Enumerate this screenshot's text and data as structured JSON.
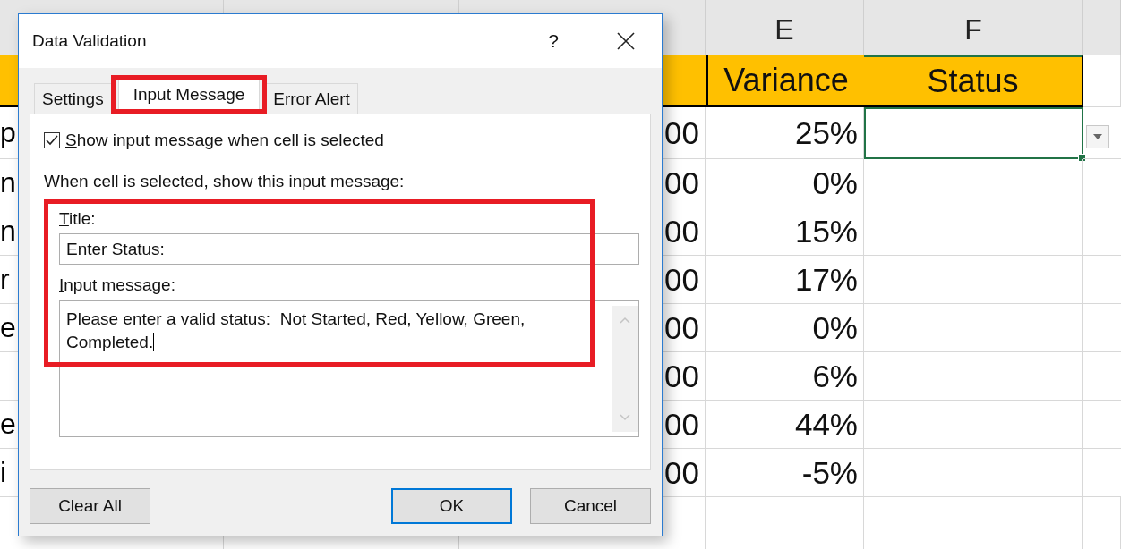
{
  "sheet": {
    "column_letters": [
      "E",
      "F"
    ],
    "header_row": [
      "Variance",
      "Status"
    ],
    "rows": [
      {
        "column_a": "p",
        "column_d": "00",
        "variance": "25%",
        "selected": true
      },
      {
        "column_a": "n",
        "column_d": "00",
        "variance": "0%",
        "selected": false
      },
      {
        "column_a": "n",
        "column_d": "00",
        "variance": "15%",
        "selected": false
      },
      {
        "column_a": "r",
        "column_d": "00",
        "variance": "17%",
        "selected": false
      },
      {
        "column_a": "e",
        "column_d": "00",
        "variance": "0%",
        "selected": false
      },
      {
        "column_d": "00",
        "variance": "6%",
        "selected": false
      },
      {
        "column_a": "e",
        "column_d": "00",
        "variance": "44%",
        "selected": false
      },
      {
        "column_a": "i",
        "column_d": "00",
        "variance": "-5%",
        "selected": false
      }
    ]
  },
  "dialog": {
    "title": "Data Validation",
    "help": "?",
    "tabs": [
      {
        "label": "Settings",
        "selected": false
      },
      {
        "label": "Input Message",
        "selected": true
      },
      {
        "label": "Error Alert",
        "selected": false
      }
    ],
    "show_message": {
      "label": "Show input message when cell is selected",
      "checked": true
    },
    "group_label": "When cell is selected, show this input message:",
    "title_field": {
      "label": "Title:",
      "value": "Enter Status:"
    },
    "message_field": {
      "label": "Input message:",
      "value": "Please enter a valid status:  Not Started, Red, Yellow, Green, Completed."
    },
    "buttons": [
      {
        "label": "Clear All",
        "default": false
      },
      {
        "label": "OK",
        "default": true
      },
      {
        "label": "Cancel",
        "default": false
      }
    ]
  }
}
